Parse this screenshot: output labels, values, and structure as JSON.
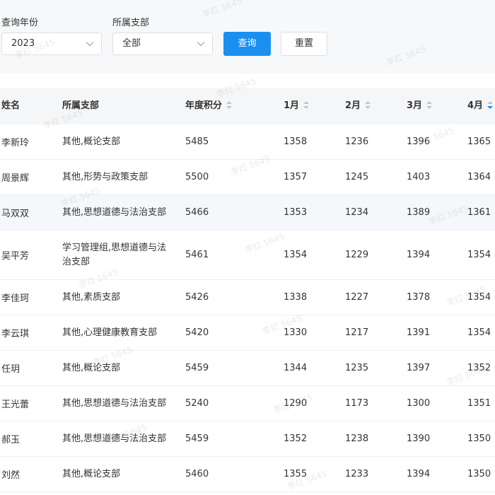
{
  "filters": {
    "year_label": "查询年份",
    "year_value": "2023",
    "branch_label": "所属支部",
    "branch_value": "全部",
    "query_button": "查询",
    "reset_button": "重置"
  },
  "table": {
    "headers": {
      "name": "姓名",
      "branch": "所属支部",
      "annual": "年度积分",
      "m1": "1月",
      "m2": "2月",
      "m3": "3月",
      "m4": "4月"
    },
    "sort": {
      "m4": "descending"
    },
    "rows": [
      {
        "name": "李新玲",
        "branch": "其他,概论支部",
        "annual": "5485",
        "m1": "1358",
        "m2": "1236",
        "m3": "1396",
        "m4": "1365"
      },
      {
        "name": "周景辉",
        "branch": "其他,形势与政策支部",
        "annual": "5500",
        "m1": "1357",
        "m2": "1245",
        "m3": "1403",
        "m4": "1364"
      },
      {
        "name": "马双双",
        "branch": "其他,思想道德与法治支部",
        "annual": "5466",
        "m1": "1353",
        "m2": "1234",
        "m3": "1389",
        "m4": "1361"
      },
      {
        "name": "吴平芳",
        "branch": "学习管理组,思想道德与法治支部",
        "annual": "5461",
        "m1": "1354",
        "m2": "1229",
        "m3": "1394",
        "m4": "1354"
      },
      {
        "name": "李佳珂",
        "branch": "其他,素质支部",
        "annual": "5426",
        "m1": "1338",
        "m2": "1227",
        "m3": "1378",
        "m4": "1354"
      },
      {
        "name": "李云琪",
        "branch": "其他,心理健康教育支部",
        "annual": "5420",
        "m1": "1330",
        "m2": "1217",
        "m3": "1391",
        "m4": "1354"
      },
      {
        "name": "任玥",
        "branch": "其他,概论支部",
        "annual": "5459",
        "m1": "1344",
        "m2": "1235",
        "m3": "1397",
        "m4": "1352"
      },
      {
        "name": "王光蕾",
        "branch": "其他,思想道德与法治支部",
        "annual": "5240",
        "m1": "1290",
        "m2": "1173",
        "m3": "1300",
        "m4": "1351"
      },
      {
        "name": "郝玉",
        "branch": "其他,思想道德与法治支部",
        "annual": "5459",
        "m1": "1352",
        "m2": "1238",
        "m3": "1390",
        "m4": "1350"
      },
      {
        "name": "刘然",
        "branch": "其他,概论支部",
        "annual": "5460",
        "m1": "1355",
        "m2": "1233",
        "m3": "1394",
        "m4": "1350"
      }
    ]
  },
  "watermark": "李红 5645",
  "colors": {
    "primary": "#1b8ff0",
    "filter_bg": "#f7f8fa",
    "header_bg": "#f5f6f8",
    "border": "#ebeef5"
  }
}
